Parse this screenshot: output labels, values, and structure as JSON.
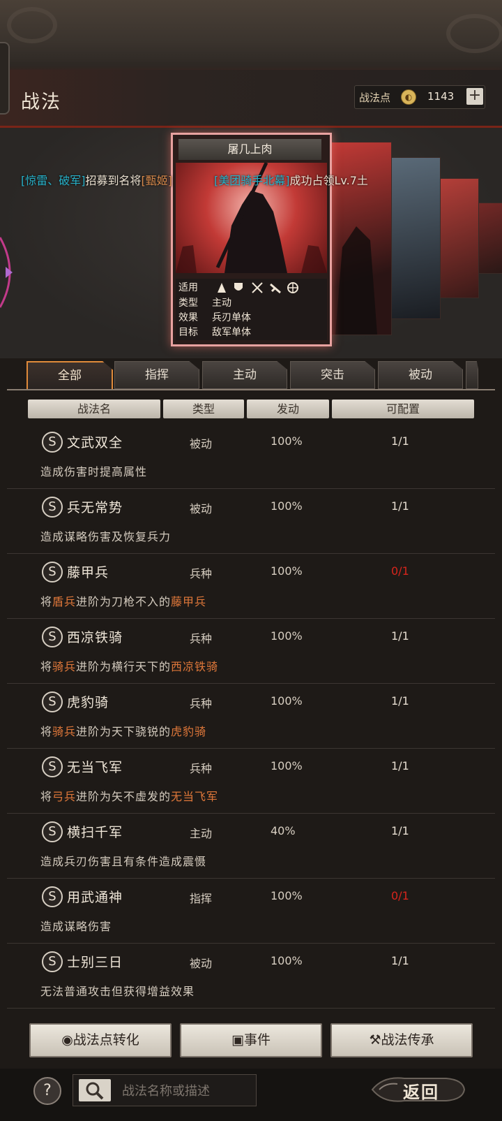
{
  "header": {
    "title": "战法",
    "points_label": "战法点",
    "points_value": "1143",
    "plus_label": "+"
  },
  "card": {
    "name": "屠几上肉",
    "applicable_label": "适用",
    "type_label": "类型",
    "type_value": "主动",
    "effect_label": "效果",
    "effect_value": "兵刃单体",
    "target_label": "目标",
    "target_value": "敌军单体"
  },
  "ticker": {
    "part1": "[惊雷、破军]",
    "part2": "招募到名将",
    "part3": "[甄姬]",
    "part4": "[美团骑手北幕]",
    "part5": "成功占领Lv.7土"
  },
  "tabs": [
    "全部",
    "指挥",
    "主动",
    "突击",
    "被动"
  ],
  "columns": [
    "战法名",
    "类型",
    "发动",
    "可配置"
  ],
  "tactics": [
    {
      "icon": "S",
      "name": "文武双全",
      "type": "被动",
      "rate": "100%",
      "config": "1/1",
      "config_red": false,
      "desc": [
        {
          "t": "造成伤害时提高属性",
          "hl": false
        }
      ]
    },
    {
      "icon": "S",
      "name": "兵无常势",
      "type": "被动",
      "rate": "100%",
      "config": "1/1",
      "config_red": false,
      "desc": [
        {
          "t": "造成谋略伤害及恢复兵力",
          "hl": false
        }
      ]
    },
    {
      "icon": "S",
      "name": "藤甲兵",
      "type": "兵种",
      "rate": "100%",
      "config": "0/1",
      "config_red": true,
      "desc": [
        {
          "t": "将",
          "hl": false
        },
        {
          "t": "盾兵",
          "hl": true
        },
        {
          "t": "进阶为刀枪不入的",
          "hl": false
        },
        {
          "t": "藤甲兵",
          "hl": true
        }
      ]
    },
    {
      "icon": "S",
      "name": "西凉铁骑",
      "type": "兵种",
      "rate": "100%",
      "config": "1/1",
      "config_red": false,
      "desc": [
        {
          "t": "将",
          "hl": false
        },
        {
          "t": "骑兵",
          "hl": true
        },
        {
          "t": "进阶为横行天下的",
          "hl": false
        },
        {
          "t": "西凉铁骑",
          "hl": true
        }
      ]
    },
    {
      "icon": "S",
      "name": "虎豹骑",
      "type": "兵种",
      "rate": "100%",
      "config": "1/1",
      "config_red": false,
      "desc": [
        {
          "t": "将",
          "hl": false
        },
        {
          "t": "骑兵",
          "hl": true
        },
        {
          "t": "进阶为天下骁锐的",
          "hl": false
        },
        {
          "t": "虎豹骑",
          "hl": true
        }
      ]
    },
    {
      "icon": "S",
      "name": "无当飞军",
      "type": "兵种",
      "rate": "100%",
      "config": "1/1",
      "config_red": false,
      "desc": [
        {
          "t": "将",
          "hl": false
        },
        {
          "t": "弓兵",
          "hl": true
        },
        {
          "t": "进阶为矢不虚发的",
          "hl": false
        },
        {
          "t": "无当飞军",
          "hl": true
        }
      ]
    },
    {
      "icon": "S",
      "name": "横扫千军",
      "type": "主动",
      "rate": "40%",
      "config": "1/1",
      "config_red": false,
      "desc": [
        {
          "t": "造成兵刃伤害且有条件造成震慑",
          "hl": false
        }
      ]
    },
    {
      "icon": "S",
      "name": "用武通神",
      "type": "指挥",
      "rate": "100%",
      "config": "0/1",
      "config_red": true,
      "desc": [
        {
          "t": "造成谋略伤害",
          "hl": false
        }
      ]
    },
    {
      "icon": "S",
      "name": "士别三日",
      "type": "被动",
      "rate": "100%",
      "config": "1/1",
      "config_red": false,
      "desc": [
        {
          "t": "无法普通攻击但获得增益效果",
          "hl": false
        }
      ]
    }
  ],
  "buttons": {
    "convert": "战法点转化",
    "events": "事件",
    "inherit": "战法传承"
  },
  "footer": {
    "help": "?",
    "search_placeholder": "战法名称或描述",
    "back": "返回"
  },
  "colors": {
    "highlight": "#e0783a",
    "unavailable": "#d8251c",
    "ticker_name": "#27b0c8"
  }
}
